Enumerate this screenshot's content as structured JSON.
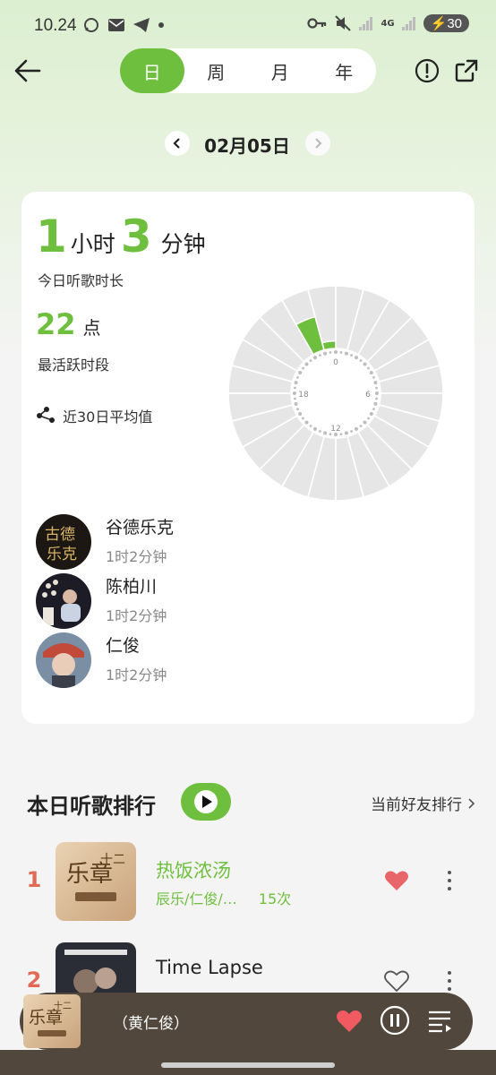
{
  "status_bar": {
    "time": "10.24",
    "battery": "30",
    "network": "4G"
  },
  "tabs": [
    {
      "label": "日",
      "active": true
    },
    {
      "label": "周",
      "active": false
    },
    {
      "label": "月",
      "active": false
    },
    {
      "label": "年",
      "active": false
    }
  ],
  "date": "02月05日",
  "summary": {
    "hours": "1",
    "hours_unit": "小时",
    "minutes": "3",
    "minutes_unit": "分钟",
    "duration_label": "今日听歌时长",
    "peak_hour": "22",
    "peak_unit": "点",
    "peak_label": "最活跃时段",
    "avg_label": "近30日平均值"
  },
  "clock": {
    "labels": {
      "top": "0",
      "right": "6",
      "bottom": "12",
      "left": "18"
    },
    "active_hours": [
      {
        "hour": 22,
        "level": 0.55
      },
      {
        "hour": 23,
        "level": 0.12
      }
    ],
    "accent": "#6fbf3f"
  },
  "artists": [
    {
      "name": "谷德乐克",
      "time": "1时2分钟"
    },
    {
      "name": "陈柏川",
      "time": "1时2分钟"
    },
    {
      "name": "仁俊",
      "time": "1时2分钟"
    }
  ],
  "ranking": {
    "title": "本日听歌排行",
    "friends_label": "当前好友排行",
    "songs": [
      {
        "rank": "1",
        "title": "热饭浓汤",
        "artists": "辰乐/仁俊/…",
        "plays": "15次",
        "liked": true
      },
      {
        "rank": "2",
        "title": "Time Lapse",
        "artists": "",
        "plays": "",
        "liked": false
      }
    ]
  },
  "now_playing": {
    "title": "（黄仁俊）"
  },
  "colors": {
    "accent": "#6fbf3f",
    "rank": "#e06a55",
    "heart": "#e8656a",
    "player": "#51473c"
  }
}
